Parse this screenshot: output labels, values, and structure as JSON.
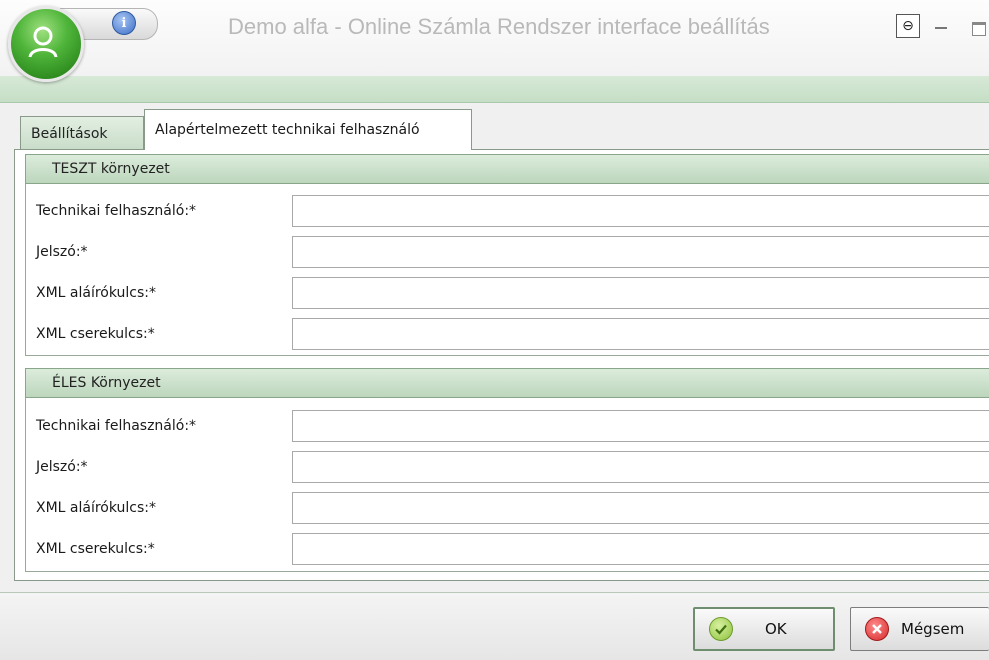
{
  "window": {
    "title": "Demo alfa  - Online Számla Rendszer interface beállítás",
    "pin_glyph": "⊖",
    "info_glyph": "i"
  },
  "tabs": [
    {
      "label": "Beállítások",
      "active": false
    },
    {
      "label": "Alapértelmezett technikai felhasználó",
      "active": true
    }
  ],
  "groups": [
    {
      "title": "TESZT környezet",
      "fields": [
        {
          "label": "Technikai felhasználó:*",
          "value": ""
        },
        {
          "label": "Jelszó:*",
          "value": ""
        },
        {
          "label": "XML aláírókulcs:*",
          "value": ""
        },
        {
          "label": "XML cserekulcs:*",
          "value": ""
        }
      ]
    },
    {
      "title": "ÉLES Környezet",
      "fields": [
        {
          "label": "Technikai felhasználó:*",
          "value": ""
        },
        {
          "label": "Jelszó:*",
          "value": ""
        },
        {
          "label": "XML aláírókulcs:*",
          "value": ""
        },
        {
          "label": "XML cserekulcs:*",
          "value": ""
        }
      ]
    }
  ],
  "buttons": {
    "ok": "OK",
    "cancel": "Mégsem"
  },
  "colors": {
    "accent_green": "#4fb53a",
    "header_green": "#c5dec5"
  },
  "icons": {
    "app": "app-logo-icon",
    "info": "info-icon",
    "pin": "pin-icon",
    "minimize": "minimize-icon",
    "maximize": "maximize-icon",
    "ok": "check-icon",
    "cancel": "cancel-x-icon"
  }
}
